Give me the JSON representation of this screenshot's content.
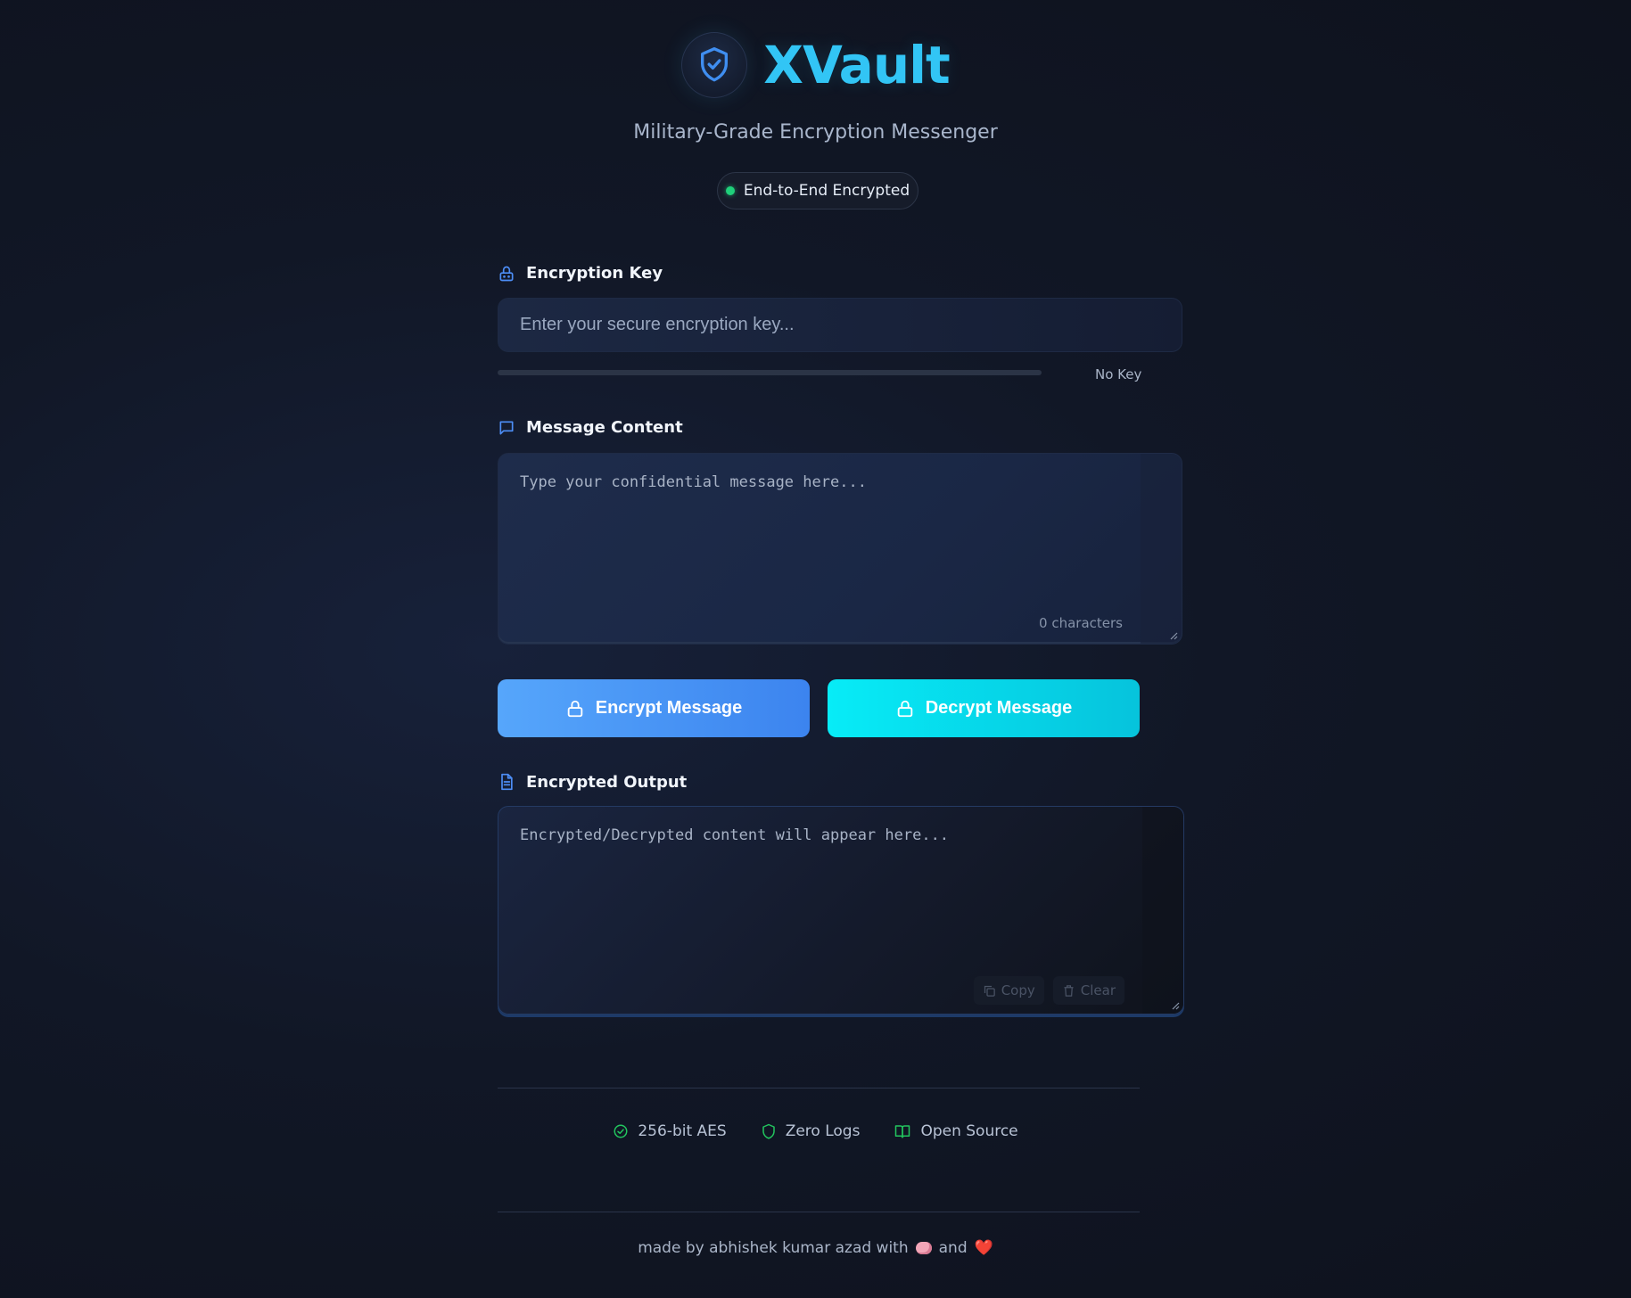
{
  "brand": {
    "title": "XVault",
    "subtitle": "Military-Grade Encryption Messenger",
    "status": "End-to-End Encrypted",
    "logo_icon": "shield-check-icon",
    "accent": "#32c5f5"
  },
  "key": {
    "label": "Encryption Key",
    "placeholder": "Enter your secure encryption key...",
    "value": "",
    "strength_label": "No Key",
    "strength_percent": 0
  },
  "message": {
    "label": "Message Content",
    "placeholder": "Type your confidential message here...",
    "value": "",
    "char_count": "0 characters"
  },
  "actions": {
    "encrypt_label": "Encrypt Message",
    "decrypt_label": "Decrypt Message",
    "encrypt_color": "#3c84ef",
    "decrypt_color": "#06c3dc"
  },
  "output": {
    "label": "Encrypted Output",
    "placeholder": "Encrypted/Decrypted content will appear here...",
    "value": "",
    "copy_label": "Copy",
    "clear_label": "Clear"
  },
  "features": [
    {
      "label": "256-bit AES",
      "icon": "check-circle-icon"
    },
    {
      "label": "Zero Logs",
      "icon": "shield-icon"
    },
    {
      "label": "Open Source",
      "icon": "book-icon"
    }
  ],
  "footer": {
    "prefix": "made by abhishek kumar azad with",
    "and": "and",
    "heart": "❤️"
  }
}
